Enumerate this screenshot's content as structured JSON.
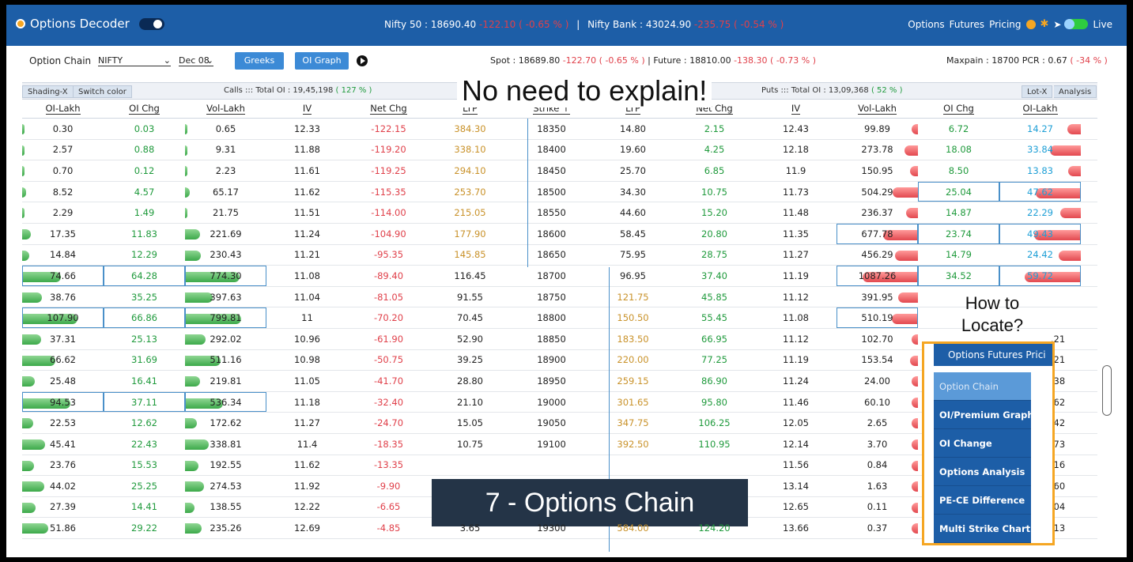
{
  "topbar": {
    "brand": "Options Decoder",
    "nifty_label": "Nifty 50 : 18690.40",
    "nifty_change": "-122.10 ( -0.65 % )",
    "separator": "|",
    "banknifty_label": "Nifty Bank : 43024.90",
    "banknifty_change": "-235.75 ( -0.54 % )",
    "nav": [
      "Options",
      "Futures",
      "Pricing"
    ],
    "live_label": "Live"
  },
  "controls": {
    "option_chain_label": "Option Chain",
    "symbol": "NIFTY",
    "expiry": "Dec 08",
    "greeks_button": "Greeks",
    "oigraph_button": "OI Graph",
    "spot_label": "Spot : 18689.80",
    "spot_change": "-122.70 ( -0.65 % )",
    "future_label": "Future : 18810.00",
    "future_change": "-138.30 ( -0.73 % )",
    "maxpain": "Maxpain : 18700",
    "pcr": "PCR : 0.67",
    "pcr_change": "( -34 % )"
  },
  "subhead": {
    "shading": "Shading-X",
    "switch": "Switch color",
    "calls": "Calls ::: Total OI : 19,45,198",
    "calls_pct": "( 127 % )",
    "puts": "Puts ::: Total OI : 13,09,368",
    "puts_pct": "( 52 % )",
    "lotx": "Lot-X",
    "analysis": "Analysis"
  },
  "columns": [
    "OI-Lakh",
    "OI Chg",
    "Vol-Lakh",
    "IV",
    "Net Chg",
    "LTP",
    "Strike ↑",
    "LTP",
    "Net Chg",
    "IV",
    "Vol-Lakh",
    "OI Chg",
    "OI-Lakh"
  ],
  "rows": [
    [
      "0.30",
      "0.03",
      "0.65",
      "12.33",
      "-122.15",
      "384.30",
      "18350",
      "14.80",
      "2.15",
      "12.43",
      "99.89",
      "6.72",
      "14.27"
    ],
    [
      "2.57",
      "0.88",
      "9.31",
      "11.88",
      "-119.20",
      "338.10",
      "18400",
      "19.60",
      "4.25",
      "12.18",
      "273.78",
      "18.08",
      "33.84"
    ],
    [
      "0.70",
      "0.12",
      "2.23",
      "11.61",
      "-119.25",
      "294.10",
      "18450",
      "25.70",
      "6.85",
      "11.9",
      "150.95",
      "8.50",
      "13.83"
    ],
    [
      "8.52",
      "4.57",
      "65.17",
      "11.62",
      "-115.35",
      "253.70",
      "18500",
      "34.30",
      "10.75",
      "11.73",
      "504.29",
      "25.04",
      "47.62"
    ],
    [
      "2.29",
      "1.49",
      "21.75",
      "11.51",
      "-114.00",
      "215.05",
      "18550",
      "44.60",
      "15.20",
      "11.48",
      "236.37",
      "14.87",
      "22.29"
    ],
    [
      "17.35",
      "11.83",
      "221.69",
      "11.24",
      "-104.90",
      "177.90",
      "18600",
      "58.45",
      "20.80",
      "11.35",
      "677.78",
      "23.74",
      "49.43"
    ],
    [
      "14.84",
      "12.29",
      "230.43",
      "11.21",
      "-95.35",
      "145.85",
      "18650",
      "75.95",
      "28.75",
      "11.27",
      "456.29",
      "14.79",
      "24.42"
    ],
    [
      "74.66",
      "64.28",
      "774.30",
      "11.08",
      "-89.40",
      "116.45",
      "18700",
      "96.95",
      "37.40",
      "11.19",
      "1087.26",
      "34.52",
      "59.72"
    ],
    [
      "38.76",
      "35.25",
      "397.63",
      "11.04",
      "-81.05",
      "91.55",
      "18750",
      "121.75",
      "45.85",
      "11.12",
      "391.95",
      "",
      ""
    ],
    [
      "107.90",
      "66.86",
      "799.81",
      "11",
      "-70.20",
      "70.45",
      "18800",
      "150.50",
      "55.45",
      "11.08",
      "510.19",
      "",
      ""
    ],
    [
      "37.31",
      "25.13",
      "292.02",
      "10.96",
      "-61.90",
      "52.90",
      "18850",
      "183.50",
      "66.95",
      "11.12",
      "102.70",
      "",
      ""
    ],
    [
      "66.62",
      "31.69",
      "511.16",
      "10.98",
      "-50.75",
      "39.25",
      "18900",
      "220.00",
      "77.25",
      "11.19",
      "153.54",
      "",
      ""
    ],
    [
      "25.48",
      "16.41",
      "219.81",
      "11.05",
      "-41.70",
      "28.80",
      "18950",
      "259.15",
      "86.90",
      "11.24",
      "24.00",
      "",
      ""
    ],
    [
      "94.53",
      "37.11",
      "536.34",
      "11.18",
      "-32.40",
      "21.10",
      "19000",
      "301.65",
      "95.80",
      "11.46",
      "60.10",
      "",
      ""
    ],
    [
      "22.53",
      "12.62",
      "172.62",
      "11.27",
      "-24.70",
      "15.05",
      "19050",
      "347.75",
      "106.25",
      "12.05",
      "2.65",
      "",
      ""
    ],
    [
      "45.41",
      "22.43",
      "338.81",
      "11.4",
      "-18.35",
      "10.75",
      "19100",
      "392.50",
      "110.95",
      "12.14",
      "3.70",
      "",
      ""
    ],
    [
      "23.76",
      "15.53",
      "192.55",
      "11.62",
      "-13.35",
      "",
      "",
      "",
      "",
      "11.56",
      "0.84",
      "",
      ""
    ],
    [
      "44.02",
      "25.25",
      "274.53",
      "11.92",
      "-9.90",
      "",
      "",
      "",
      "",
      "13.14",
      "1.63",
      "",
      ""
    ],
    [
      "27.39",
      "14.41",
      "138.55",
      "12.22",
      "-6.65",
      "",
      "",
      "",
      "",
      "12.65",
      "0.11",
      "",
      ""
    ],
    [
      "51.86",
      "29.22",
      "235.26",
      "12.69",
      "-4.85",
      "3.65",
      "19300",
      "584.00",
      "124.20",
      "13.66",
      "0.37",
      "",
      ""
    ]
  ],
  "partial_right": [
    "",
    ".21",
    ".21",
    ".38",
    ".62",
    ".42",
    ".73",
    ".16",
    ".60",
    ".04",
    ".13"
  ],
  "overlay": {
    "title": "No need to explain!",
    "locate": "How to Locate?",
    "banner": "7 - Options Chain"
  },
  "menu": {
    "top": "Options Futures Prici",
    "items": [
      "Option Chain",
      "OI/Premium Graph",
      "OI Change",
      "Options Analysis",
      "PE-CE Difference",
      "Multi Strike Chart"
    ]
  }
}
